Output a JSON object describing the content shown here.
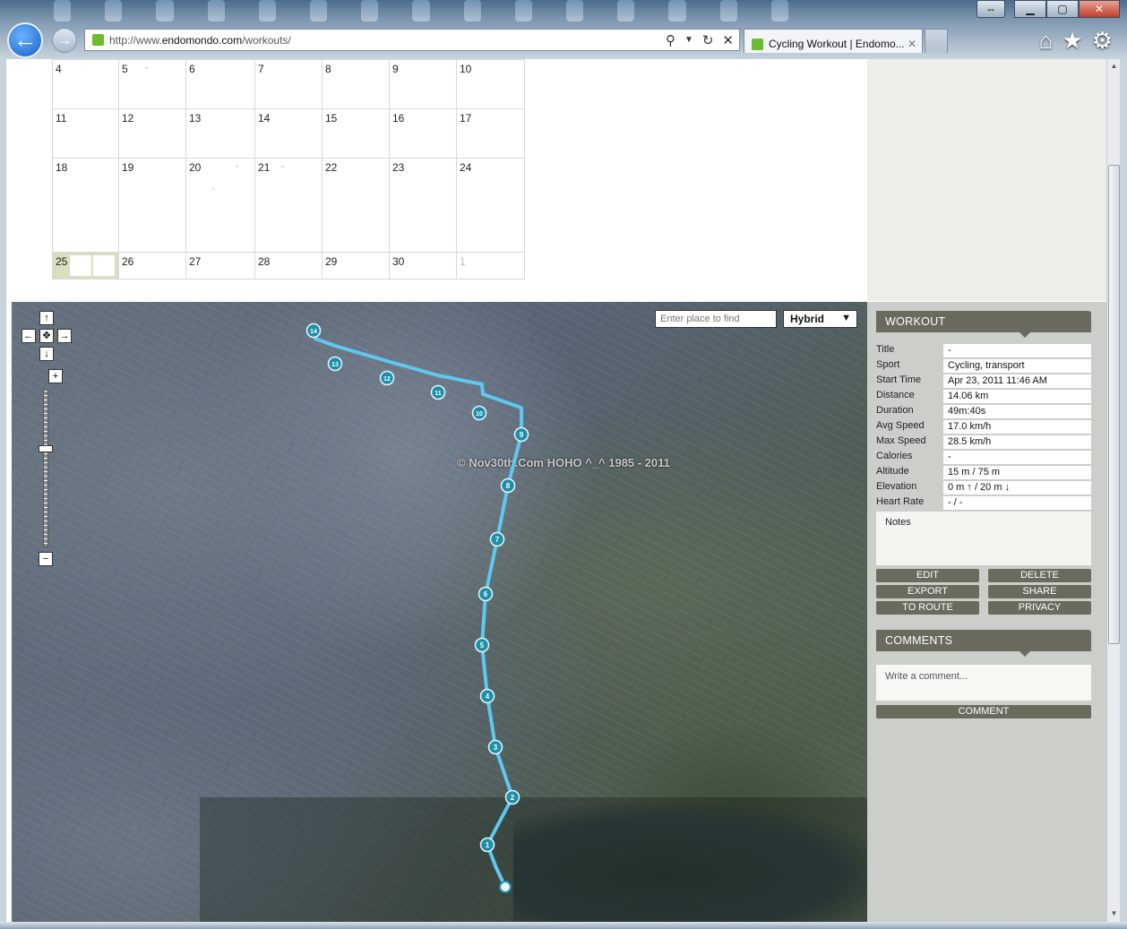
{
  "browser": {
    "url_prefix": "http://www.",
    "url_domain": "endomondo.com",
    "url_path": "/workouts/",
    "tab_title": "Cycling Workout | Endomo...",
    "tab_close": "✕",
    "back_glyph": "←",
    "forward_glyph": "→",
    "icons": [
      "search-icon",
      "dropdown-icon",
      "refresh-icon",
      "stop-icon",
      "home-icon",
      "favorites-star-icon",
      "tools-gear-icon"
    ]
  },
  "calendar": {
    "weeks": [
      [
        {
          "day": "4",
          "icons": []
        },
        {
          "day": "5",
          "icons": [
            "run",
            "bike"
          ]
        },
        {
          "day": "6",
          "icons": [
            "bike",
            "bike"
          ]
        },
        {
          "day": "7",
          "icons": [
            "bike",
            "bike"
          ]
        },
        {
          "day": "8",
          "icons": [
            "bike",
            "bike",
            "bike"
          ]
        },
        {
          "day": "9",
          "icons": []
        },
        {
          "day": "10",
          "icons": []
        }
      ],
      [
        {
          "day": "11",
          "icons": [
            "bike",
            "bike",
            "bike",
            "bike"
          ]
        },
        {
          "day": "12",
          "icons": [
            "bike"
          ]
        },
        {
          "day": "13",
          "icons": [
            "bike",
            "bike"
          ]
        },
        {
          "day": "14",
          "icons": [
            "bike",
            "bike"
          ]
        },
        {
          "day": "15",
          "icons": []
        },
        {
          "day": "16",
          "icons": []
        },
        {
          "day": "17",
          "icons": []
        }
      ],
      [
        {
          "day": "18",
          "icons": [
            "bike",
            "bike",
            "bike",
            "bike"
          ]
        },
        {
          "day": "19",
          "icons": [
            "bike",
            "bike"
          ]
        },
        {
          "day": "20",
          "icons": [
            "bike",
            "walk",
            "walk"
          ]
        },
        {
          "day": "21",
          "icons": [
            "walk"
          ]
        },
        {
          "day": "22",
          "icons": [
            "bike"
          ]
        },
        {
          "day": "23",
          "icons": [
            "bike",
            "bike",
            "bike",
            "bike",
            "bike",
            "bike",
            "bike-selected"
          ]
        },
        {
          "day": "24",
          "icons": []
        }
      ],
      [
        {
          "day": "25",
          "icons": [
            "bike",
            "bike"
          ],
          "highlight": true
        },
        {
          "day": "26",
          "icons": []
        },
        {
          "day": "27",
          "icons": []
        },
        {
          "day": "28",
          "icons": []
        },
        {
          "day": "29",
          "icons": []
        },
        {
          "day": "30",
          "icons": []
        },
        {
          "day": "1",
          "icons": [],
          "gray": true
        }
      ]
    ]
  },
  "map": {
    "search_placeholder": "Enter place to find",
    "map_type": "Hybrid",
    "watermark": "© Nov30th.Com HOHO ^_^ 1985 - 2011",
    "route_color": "#5ec8f0",
    "marker_color": "#1e8fa8",
    "pan_up": "↑",
    "pan_down": "↓",
    "pan_left": "←",
    "pan_right": "→",
    "pan_center": "✥",
    "zoom_in": "+",
    "zoom_out": "−",
    "km_markers": [
      "1",
      "2",
      "3",
      "4",
      "5",
      "6",
      "7",
      "8",
      "9",
      "10",
      "11",
      "12",
      "13",
      "14"
    ]
  },
  "workout": {
    "heading": "WORKOUT",
    "fields": [
      {
        "label": "Title",
        "value": "-"
      },
      {
        "label": "Sport",
        "value": "Cycling, transport"
      },
      {
        "label": "Start Time",
        "value": "Apr 23, 2011 11:46 AM"
      },
      {
        "label": "Distance",
        "value": "14.06 km"
      },
      {
        "label": "Duration",
        "value": "49m:40s"
      },
      {
        "label": "Avg Speed",
        "value": "17.0 km/h"
      },
      {
        "label": "Max Speed",
        "value": "28.5 km/h"
      },
      {
        "label": "Calories",
        "value": "-"
      },
      {
        "label": "Altitude",
        "value": "15 m / 75 m"
      },
      {
        "label": "Elevation",
        "value": "0 m ↑ / 20 m ↓"
      },
      {
        "label": "Heart Rate",
        "value": "- / -"
      }
    ],
    "notes_label": "Notes",
    "buttons": {
      "edit": "EDIT",
      "delete": "DELETE",
      "export": "EXPORT",
      "share": "SHARE",
      "to_route": "TO ROUTE",
      "privacy": "PRIVACY"
    }
  },
  "comments": {
    "heading": "COMMENTS",
    "placeholder": "Write a comment...",
    "button": "COMMENT"
  }
}
